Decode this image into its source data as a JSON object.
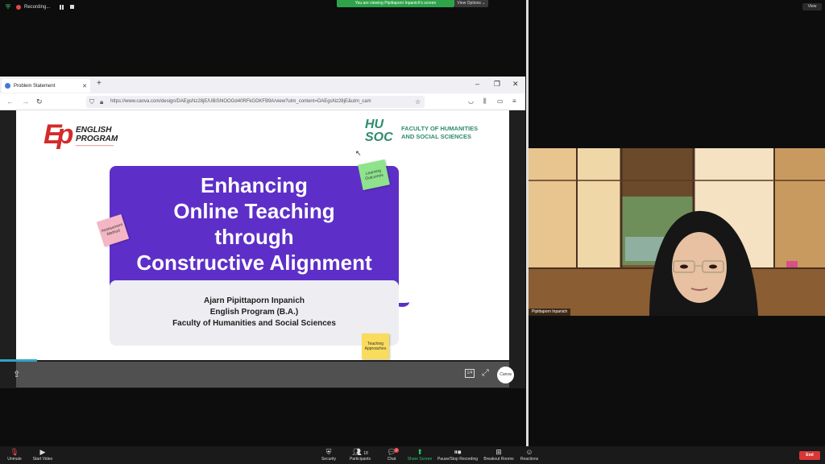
{
  "top": {
    "recording_label": "Recording...",
    "viewing_banner": "You are viewing Pipittaporn Inpanich's screen",
    "view_options": "View Options",
    "view_button": "View"
  },
  "browser": {
    "tab_title": "Problem Statement",
    "url": "https://www.canva.com/design/DAEgsNz28jE/UBiShlOOGd40RFkGDKFB9A/view?utm_content=DAEgsNz28jE&utm_cam"
  },
  "slide": {
    "ep_logo_text": "ENGLISH PROGRAM",
    "husoc_mark": "HU SOC",
    "faculty_line1": "FACULTY OF HUMANITIES",
    "faculty_line2": "AND SOCIAL SCIENCES",
    "title_lines": [
      "Enhancing",
      "Online Teaching",
      "through",
      "Constructive Alignment"
    ],
    "author": "Ajarn Pipittaporn Inpanich",
    "program": "English Program (B.A.)",
    "faculty": "Faculty of Humanities and Social Sciences",
    "sticky_green": "Learning Outcomes",
    "sticky_pink": "Assessment Method",
    "sticky_yellow": "Teaching Approaches"
  },
  "viewer": {
    "pages_icon": "1/4",
    "canva_badge": "Canva"
  },
  "video": {
    "participant_name": "Pipittaporn Inpanich"
  },
  "toolbar": {
    "unmute": "Unmute",
    "start_video": "Start Video",
    "security": "Security",
    "participants": "Participants",
    "participants_count": "18",
    "chat": "Chat",
    "chat_badge": "1",
    "share_screen": "Share Screen",
    "pause_stop_recording": "Pause/Stop Recording",
    "breakout_rooms": "Breakout Rooms",
    "reactions": "Reactions",
    "end": "End"
  },
  "colors": {
    "purple": "#5d2fc8",
    "zoom_green": "#2fa34a",
    "end_red": "#d93636"
  }
}
